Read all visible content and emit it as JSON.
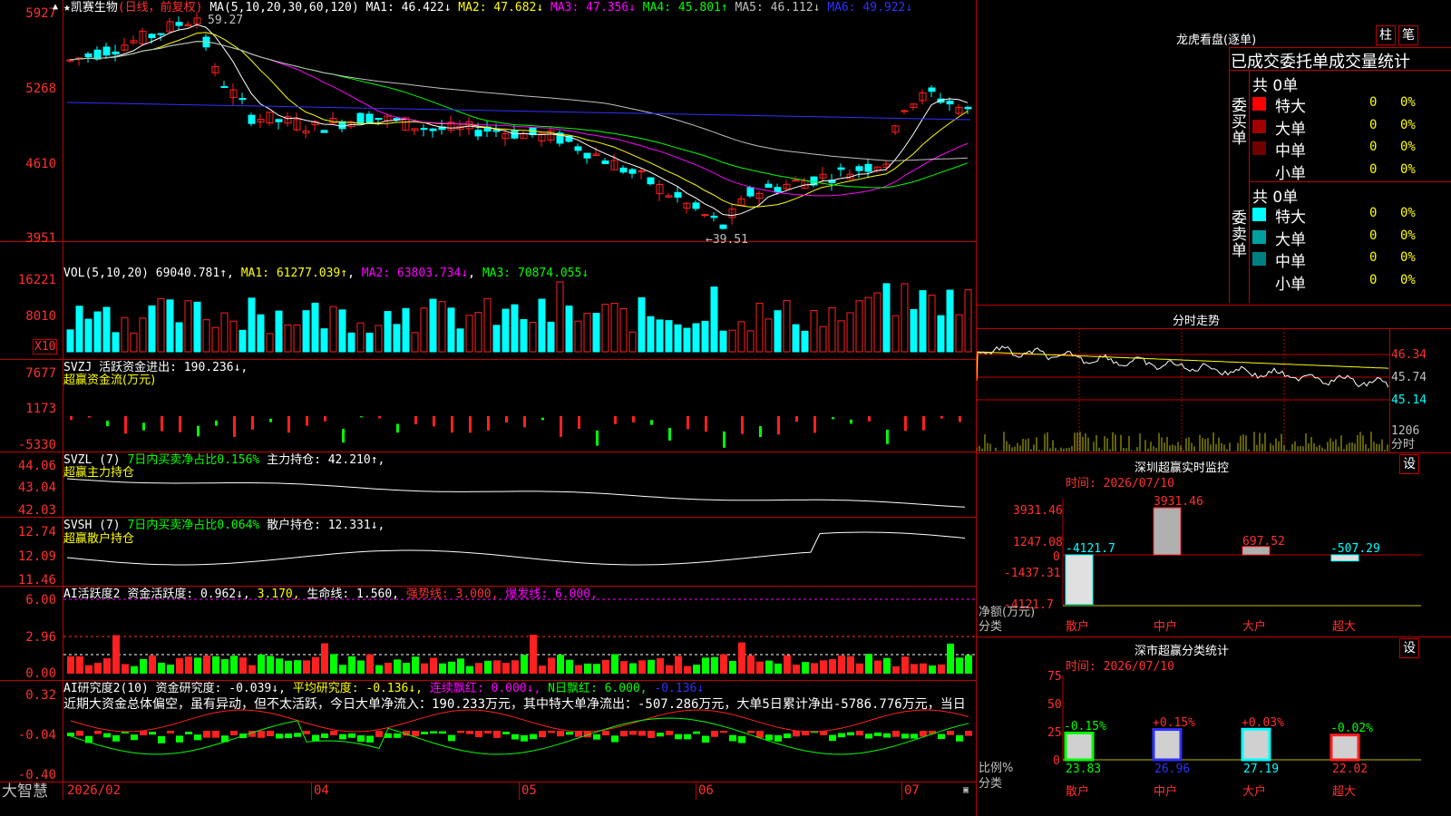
{
  "colors": {
    "up": "#ff2020",
    "down": "#00ffff",
    "frame": "#c00000",
    "ma1": "#ffffff",
    "ma2": "#ffff00",
    "ma3": "#ff00ff",
    "ma4": "#00ff00",
    "ma5": "#c0c0c0",
    "ma6": "#3030ff"
  },
  "title": {
    "star": "★",
    "stock": "凯赛生物",
    "mode": "(日线，前复权)",
    "ma_label": "MA(5,10,20,30,60,120)",
    "ma1": "MA1: 46.422↓",
    "ma2": "MA2: 47.682↓",
    "ma3": "MA3: 47.356↓",
    "ma4": "MA4: 45.801↑",
    "ma5": "MA5: 46.112↓",
    "ma6": "MA6: 49.922↓"
  },
  "price_axis": [
    "5927",
    "5268",
    "4610",
    "3951"
  ],
  "price_marks": {
    "high": "59.27",
    "low": "←39.51"
  },
  "vol": {
    "label": "VOL(5,10,20)",
    "value": "69040.781↑",
    "ma1": "MA1: 61277.039↑",
    "ma2": "MA2: 63803.734↓",
    "ma3": "MA3: 70874.055↓",
    "axis": [
      "16221",
      "8010"
    ],
    "unit": "X10"
  },
  "svzj": {
    "label": "SVZJ",
    "sub": "活跃资金进出: 190.236↓,",
    "name": "超赢资金流(万元)",
    "axis": [
      "7677",
      "1173",
      "-5330"
    ]
  },
  "svzl": {
    "label": "SVZL (7)",
    "sub": "7日内买卖净占比0.156%",
    "hold": "主力持仓: 42.210↑,",
    "name": "超赢主力持仓",
    "axis": [
      "44.06",
      "43.04",
      "42.03"
    ]
  },
  "svsh": {
    "label": "SVSH (7)",
    "sub": "7日内买卖净占比0.064%",
    "hold": "散户持仓: 12.331↓,",
    "name": "超赢散户持仓",
    "axis": [
      "12.74",
      "12.09",
      "11.46"
    ]
  },
  "ai1": {
    "label": "AI活跃度2",
    "a": "资金活跃度: 0.962↓,",
    "b": "3.170,",
    "c": "生命线: 1.560,",
    "d": "强势线: 3.000,",
    "e": "爆发线: 6.000,",
    "axis": [
      "6.00",
      "2.96",
      "0.00"
    ]
  },
  "ai2": {
    "label": "AI研究度2(10)",
    "a": "资金研究度: -0.039↓,",
    "b": "平均研究度: -0.136↓,",
    "c": "连续飘红: 0.000↓,",
    "d": "N日飘红: 6.000,",
    "e": "-0.136↓",
    "axis": [
      "0.32",
      "-0.04",
      "-0.40"
    ],
    "comment": "近期大资金总体偏空，虽有异动，但不太活跃，今日大单净流入：190.233万元，其中特大单净流出：-507.286万元，大单5日累计净出-5786.776万元，当日"
  },
  "date_axis": [
    "2026/02",
    "04",
    "05",
    "06",
    "07"
  ],
  "brand": "大智慧",
  "right": {
    "dragon_title": "龙虎看盘(逐单)",
    "btn_zhu": "柱",
    "btn_bi": "笔",
    "stat_title": "已成交委托单成交量统计",
    "buy_side": "委买单",
    "sell_side": "委卖单",
    "buy_total": "共 0单",
    "sell_total": "共 0单",
    "buy_rows": [
      {
        "name": "特大",
        "v": "0",
        "p": "0%",
        "c": "#ff0000"
      },
      {
        "name": "大单",
        "v": "0",
        "p": "0%",
        "c": "#a00000"
      },
      {
        "name": "中单",
        "v": "0",
        "p": "0%",
        "c": "#700000"
      },
      {
        "name": "小单",
        "v": "0",
        "p": "0%",
        "c": ""
      }
    ],
    "sell_rows": [
      {
        "name": "特大",
        "v": "0",
        "p": "0%",
        "c": "#00ffff"
      },
      {
        "name": "大单",
        "v": "0",
        "p": "0%",
        "c": "#00a0a0"
      },
      {
        "name": "中单",
        "v": "0",
        "p": "0%",
        "c": "#008080"
      },
      {
        "name": "小单",
        "v": "0",
        "p": "0%",
        "c": ""
      }
    ],
    "intraday_title": "分时走势",
    "intraday_axis": [
      "46.34",
      "45.74",
      "45.14",
      "1206",
      "分时"
    ],
    "sz_title": "深圳超赢实时监控",
    "sz_btn": "设",
    "sz_time": "时间: 2026/07/10",
    "sz_axis": [
      "3931.46",
      "1247.08",
      "0",
      "-1437.31",
      "-4121.7"
    ],
    "sz_values": {
      "retail": "-4121.7",
      "mid": "3931.46",
      "large": "697.52",
      "xl": "-507.29"
    },
    "sz_ylabel": "净额(万元)",
    "sz_xlabel": "分类",
    "cats": [
      "散户",
      "中户",
      "大户",
      "超大"
    ],
    "cls_title": "深市超赢分类统计",
    "cls_btn": "设",
    "cls_time": "时间: 2026/07/10",
    "cls_axis": [
      "75",
      "50",
      "25",
      "0"
    ],
    "cls_pct": [
      "-0.15%",
      "+0.15%",
      "+0.03%",
      "-0.02%"
    ],
    "cls_vals": [
      "23.83",
      "26.96",
      "27.19",
      "22.02"
    ],
    "cls_ylabel": "比例%",
    "cls_xlabel": "分类"
  }
}
